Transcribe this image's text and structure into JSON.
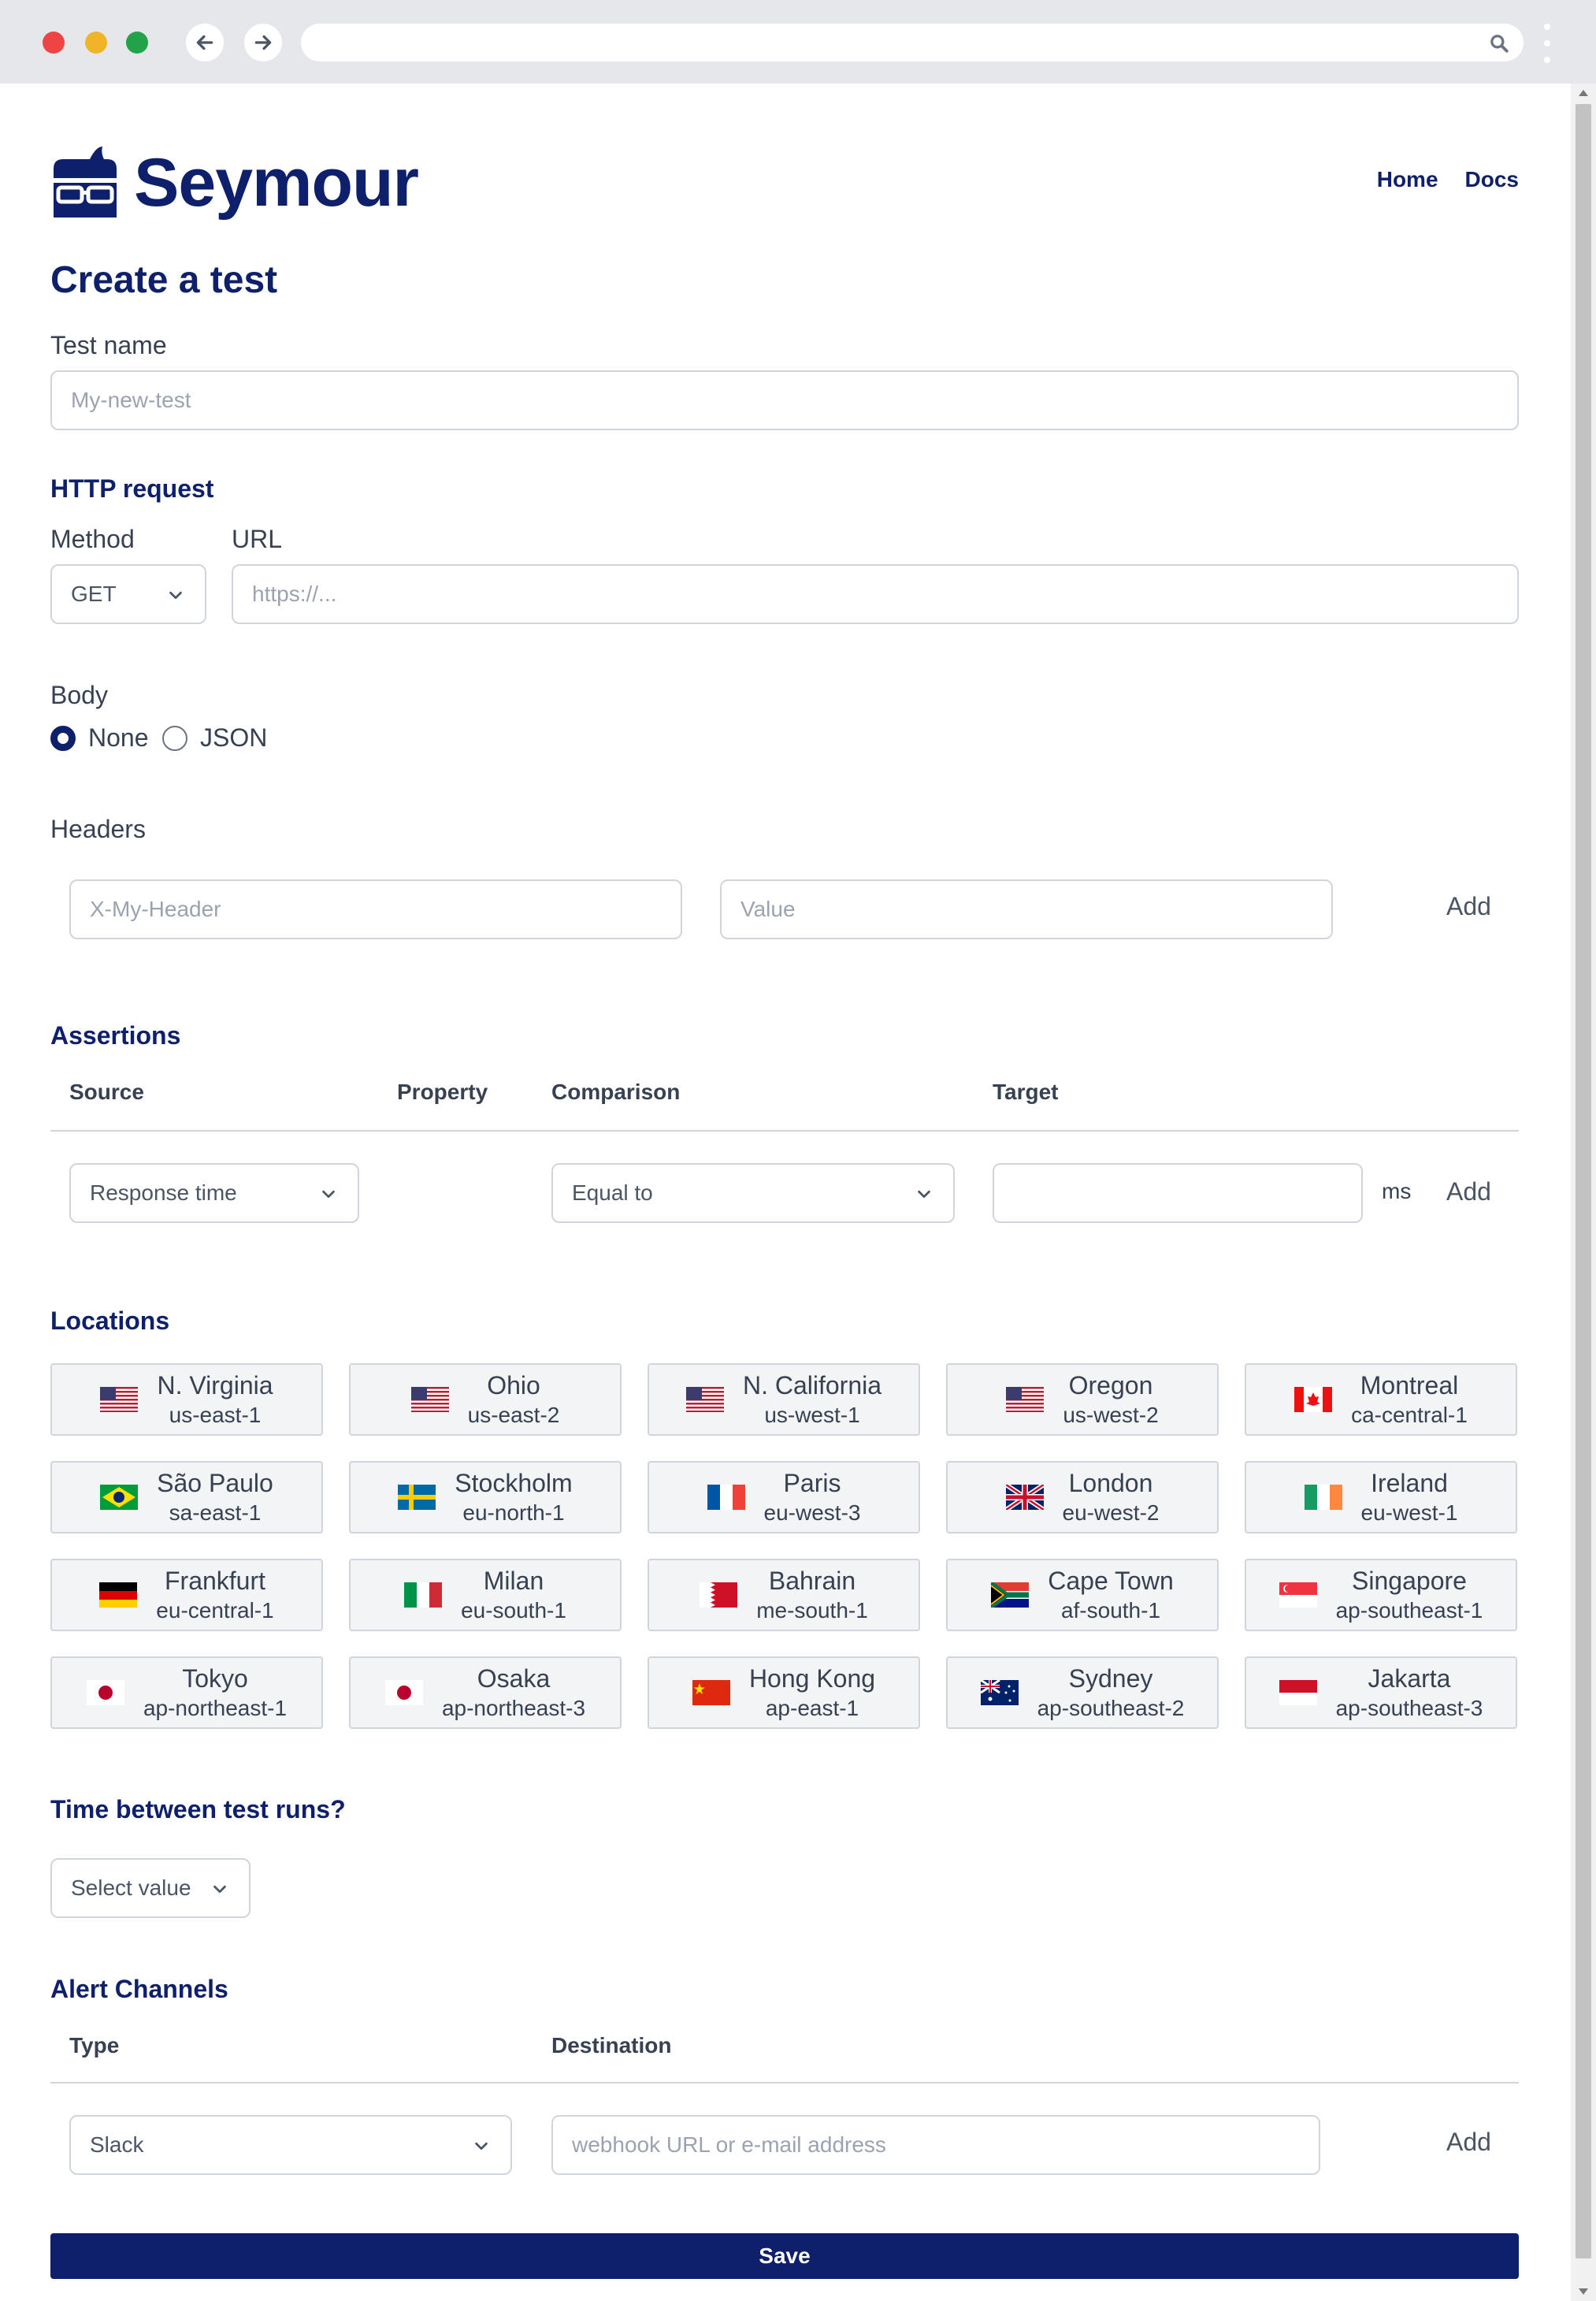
{
  "brand": {
    "name": "Seymour"
  },
  "nav": {
    "home": "Home",
    "docs": "Docs"
  },
  "form": {
    "title": "Create a test",
    "test_name_label": "Test name",
    "test_name_placeholder": "My-new-test",
    "http_request_heading": "HTTP request",
    "method_label": "Method",
    "method_value": "GET",
    "url_label": "URL",
    "url_placeholder": "https://...",
    "body_label": "Body",
    "body_options": [
      {
        "label": "None",
        "selected": true
      },
      {
        "label": "JSON",
        "selected": false
      }
    ],
    "headers_label": "Headers",
    "header_name_placeholder": "X-My-Header",
    "header_value_placeholder": "Value",
    "add_label": "Add"
  },
  "assertions": {
    "heading": "Assertions",
    "columns": [
      "Source",
      "Property",
      "Comparison",
      "Target"
    ],
    "source_value": "Response time",
    "comparison_value": "Equal to",
    "target_value": "",
    "unit": "ms",
    "add_label": "Add"
  },
  "locations": {
    "heading": "Locations",
    "items": [
      {
        "city": "N. Virginia",
        "region": "us-east-1",
        "flag": "us-flag-icon"
      },
      {
        "city": "Ohio",
        "region": "us-east-2",
        "flag": "us-flag-icon"
      },
      {
        "city": "N. California",
        "region": "us-west-1",
        "flag": "us-flag-icon"
      },
      {
        "city": "Oregon",
        "region": "us-west-2",
        "flag": "us-flag-icon"
      },
      {
        "city": "Montreal",
        "region": "ca-central-1",
        "flag": "ca-flag-icon"
      },
      {
        "city": "São Paulo",
        "region": "sa-east-1",
        "flag": "br-flag-icon"
      },
      {
        "city": "Stockholm",
        "region": "eu-north-1",
        "flag": "se-flag-icon"
      },
      {
        "city": "Paris",
        "region": "eu-west-3",
        "flag": "fr-flag-icon"
      },
      {
        "city": "London",
        "region": "eu-west-2",
        "flag": "gb-flag-icon"
      },
      {
        "city": "Ireland",
        "region": "eu-west-1",
        "flag": "ie-flag-icon"
      },
      {
        "city": "Frankfurt",
        "region": "eu-central-1",
        "flag": "de-flag-icon"
      },
      {
        "city": "Milan",
        "region": "eu-south-1",
        "flag": "it-flag-icon"
      },
      {
        "city": "Bahrain",
        "region": "me-south-1",
        "flag": "bh-flag-icon"
      },
      {
        "city": "Cape Town",
        "region": "af-south-1",
        "flag": "za-flag-icon"
      },
      {
        "city": "Singapore",
        "region": "ap-southeast-1",
        "flag": "sg-flag-icon"
      },
      {
        "city": "Tokyo",
        "region": "ap-northeast-1",
        "flag": "jp-flag-icon"
      },
      {
        "city": "Osaka",
        "region": "ap-northeast-3",
        "flag": "jp-flag-icon"
      },
      {
        "city": "Hong Kong",
        "region": "ap-east-1",
        "flag": "cn-flag-icon"
      },
      {
        "city": "Sydney",
        "region": "ap-southeast-2",
        "flag": "au-flag-icon"
      },
      {
        "city": "Jakarta",
        "region": "ap-southeast-3",
        "flag": "id-flag-icon"
      }
    ]
  },
  "schedule": {
    "heading": "Time between test runs?",
    "select_value": "Select value"
  },
  "alerts": {
    "heading": "Alert Channels",
    "columns": [
      "Type",
      "Destination"
    ],
    "type_value": "Slack",
    "destination_placeholder": "webhook URL or e-mail address",
    "add_label": "Add"
  },
  "save_label": "Save",
  "colors": {
    "brand": "#0e1f6b",
    "border": "#d1d5db",
    "tile": "#f3f4f6"
  }
}
